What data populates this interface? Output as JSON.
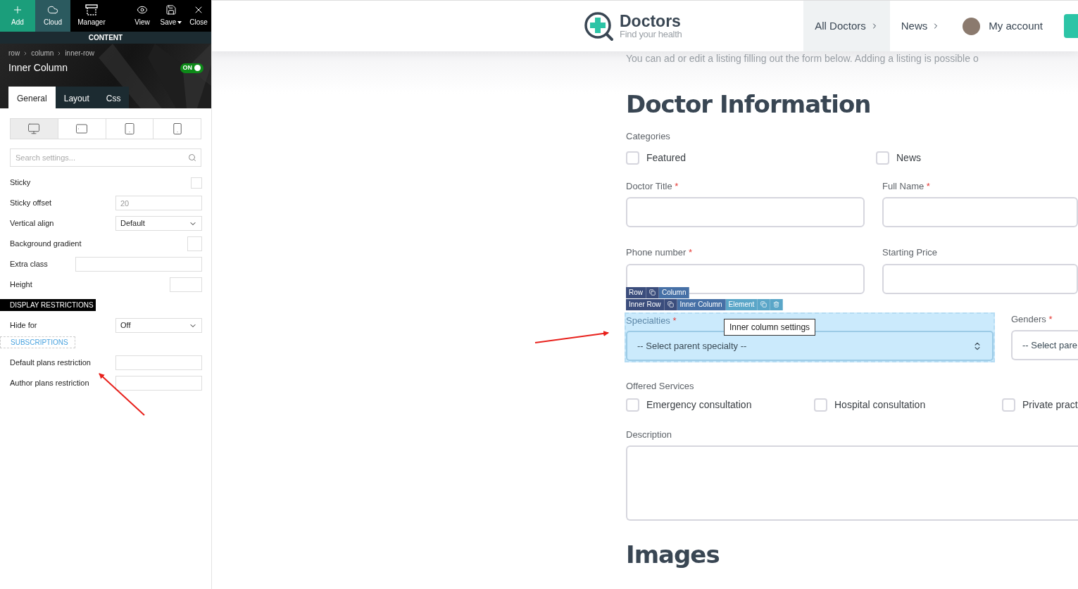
{
  "builder_panel": {
    "toolbar": [
      {
        "label": "Add",
        "kind": "add"
      },
      {
        "label": "Cloud",
        "kind": "cloud"
      },
      {
        "label": "Manager",
        "kind": "manager"
      },
      {
        "label": "View",
        "kind": "view"
      },
      {
        "label": "Save",
        "kind": "save",
        "has_menu": true
      },
      {
        "label": "Close",
        "kind": "close"
      }
    ],
    "section_title": "CONTENT",
    "breadcrumb": [
      "row",
      "column",
      "inner-row"
    ],
    "title": "Inner Column",
    "toggle": {
      "label": "ON",
      "on": true
    },
    "tabs": [
      {
        "label": "General",
        "selected": true
      },
      {
        "label": "Layout",
        "selected": false
      },
      {
        "label": "Css",
        "selected": false
      }
    ],
    "devices": [
      {
        "kind": "desktop",
        "selected": true
      },
      {
        "kind": "tablet-landscape",
        "selected": false
      },
      {
        "kind": "tablet",
        "selected": false
      },
      {
        "kind": "mobile",
        "selected": false
      }
    ],
    "search": {
      "placeholder": "Search settings..."
    },
    "settings": [
      {
        "label": "Sticky",
        "kind": "checkbox",
        "checked": false
      },
      {
        "label": "Sticky offset",
        "kind": "text",
        "placeholder": "20"
      },
      {
        "label": "Vertical align",
        "kind": "select",
        "value": "Default"
      },
      {
        "label": "Background gradient",
        "kind": "swatch"
      },
      {
        "label": "Extra class",
        "kind": "wide-text"
      },
      {
        "label": "Height",
        "kind": "small-text"
      }
    ],
    "restrictions_header": "DISPLAY RESTRICTIONS",
    "restrictions": [
      {
        "label": "Hide for",
        "kind": "select",
        "value": "Off"
      }
    ],
    "subscriptions_header": "SUBSCRIPTIONS",
    "subscriptions": [
      {
        "label": "Default plans restriction",
        "kind": "text"
      },
      {
        "label": "Author plans restriction",
        "kind": "text"
      }
    ]
  },
  "site": {
    "logo": {
      "name": "Doctors",
      "tagline": "Find your health"
    },
    "nav": [
      {
        "label": "All Doctors",
        "selected": true
      },
      {
        "label": "News",
        "selected": false
      }
    ],
    "account": "My account",
    "intro": "You can ad or edit a listing filling out the form below.  Adding a listing is possible o",
    "heading": "Doctor Information",
    "categories": {
      "label": "Categories",
      "options": [
        {
          "label": "Featured",
          "checked": false
        },
        {
          "label": "News",
          "checked": false
        }
      ]
    },
    "field_rows": [
      [
        {
          "label": "Doctor Title",
          "required_mark": "*",
          "kind": "input"
        },
        {
          "label": "Full Name",
          "required_mark": "*",
          "kind": "input"
        }
      ],
      [
        {
          "label": "Phone number",
          "required_mark": "*",
          "kind": "input"
        },
        {
          "label": "Starting Price",
          "kind": "input"
        }
      ],
      [
        {
          "label": "Specialties",
          "required_mark": "*",
          "kind": "select",
          "value": "-- Select parent specialty --",
          "highlighted": true
        },
        {
          "label": "Genders",
          "required_mark": "*",
          "kind": "select",
          "value": "-- Select pare",
          "highlighted": false
        }
      ]
    ],
    "services": {
      "label": "Offered Services",
      "options": [
        {
          "label": "Emergency consultation",
          "checked": false
        },
        {
          "label": "Hospital consultation",
          "checked": false
        },
        {
          "label": "Private pract",
          "checked": false
        }
      ]
    },
    "description": {
      "label": "Description"
    },
    "images_heading": "Images"
  },
  "builder_overlay": {
    "bars": [
      [
        {
          "label": "Row",
          "kind": "row"
        },
        {
          "kind": "row-copy"
        },
        {
          "label": "Column",
          "kind": "column"
        }
      ],
      [
        {
          "label": "Inner Row",
          "kind": "row"
        },
        {
          "kind": "row-copy"
        },
        {
          "label": "Inner Column",
          "kind": "column"
        },
        {
          "label": "Element",
          "kind": "element"
        },
        {
          "kind": "element-copy"
        },
        {
          "kind": "element-delete"
        }
      ]
    ],
    "tooltip": "Inner column settings"
  }
}
